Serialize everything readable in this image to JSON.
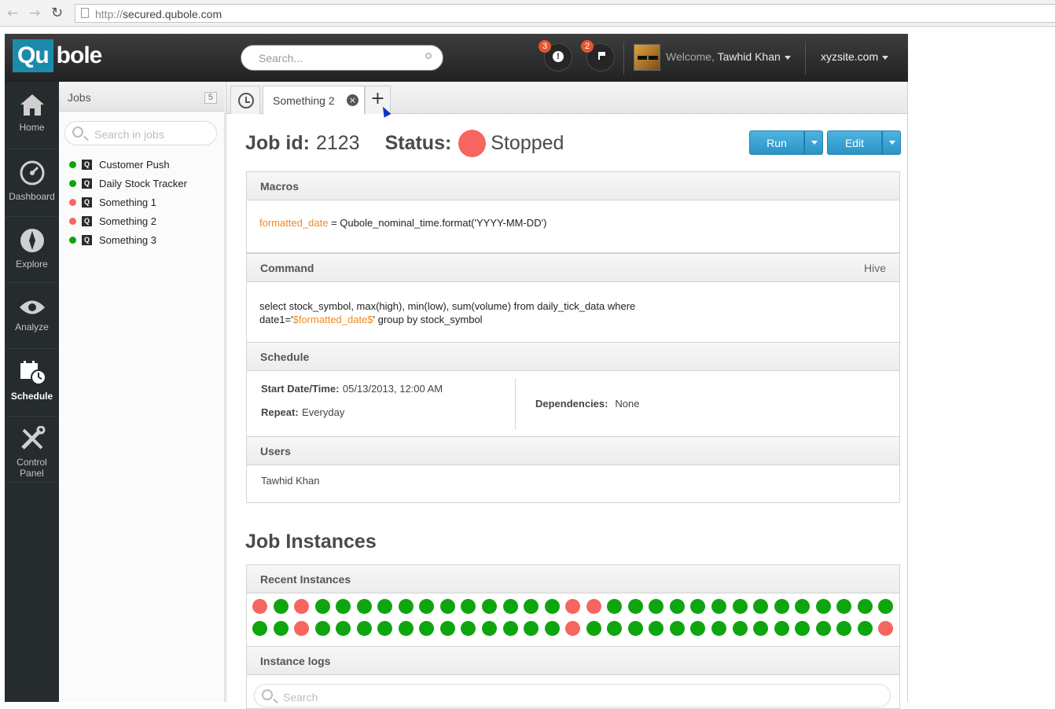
{
  "browser": {
    "url_protocol": "http://",
    "url_host": "secured.qubole.com",
    "back_glyph": "←",
    "forward_glyph": "→",
    "reload_glyph": "↻"
  },
  "topbar": {
    "logo_box": "Qu",
    "logo_rest": "bole",
    "search_placeholder": "Search...",
    "alerts_count": "3",
    "alerts_glyph": "!",
    "flags_count": "2",
    "welcome_prefix": "Welcome,",
    "user_name": "Tawhid Khan",
    "site_name": "xyzsite.com"
  },
  "leftnav": {
    "items": [
      {
        "label": "Home",
        "icon": "home-icon"
      },
      {
        "label": "Dashboard",
        "icon": "gauge-icon"
      },
      {
        "label": "Explore",
        "icon": "compass-icon"
      },
      {
        "label": "Analyze",
        "icon": "eye-icon"
      },
      {
        "label": "Schedule",
        "icon": "calendar-clock-icon"
      },
      {
        "label": "Control",
        "label2": "Panel",
        "icon": "tools-icon"
      }
    ],
    "active": "Schedule"
  },
  "jobs": {
    "title": "Jobs",
    "count": "5",
    "search_placeholder": "Search in jobs",
    "q_glyph": "Q",
    "items": [
      {
        "name": "Customer Push",
        "status": "green"
      },
      {
        "name": "Daily Stock Tracker",
        "status": "green"
      },
      {
        "name": "Something 1",
        "status": "red"
      },
      {
        "name": "Something 2",
        "status": "red"
      },
      {
        "name": "Something 3",
        "status": "green"
      }
    ]
  },
  "tabs": {
    "active_label": "Something 2",
    "close_glyph": "×",
    "new_glyph": "+"
  },
  "job": {
    "id_label": "Job id:",
    "id_value": "2123",
    "status_label": "Status:",
    "status_value": "Stopped",
    "run_label": "Run",
    "edit_label": "Edit"
  },
  "macros": {
    "title": "Macros",
    "var_name": "formatted_date",
    "rest": " = Qubole_nominal_time.format('YYYY-MM-DD')"
  },
  "command": {
    "title": "Command",
    "type": "Hive",
    "line1": "select stock_symbol, max(high), min(low), sum(volume) from daily_tick_data where",
    "line2_prefix": "date1='",
    "line2_var": "$formatted_date$",
    "line2_suffix": "' group by stock_symbol"
  },
  "schedule": {
    "title": "Schedule",
    "start_label": "Start Date/Time:",
    "start_value": "05/13/2013, 12:00 AM",
    "repeat_label": "Repeat:",
    "repeat_value": "Everyday",
    "dependencies_label": "Dependencies:",
    "dependencies_value": "None"
  },
  "users": {
    "title": "Users",
    "value": "Tawhid Khan"
  },
  "instances": {
    "heading": "Job Instances",
    "recent_title": "Recent Instances",
    "row1": [
      "red",
      "green",
      "red",
      "green",
      "green",
      "green",
      "green",
      "green",
      "green",
      "green",
      "green",
      "green",
      "green",
      "green",
      "green",
      "red",
      "red",
      "green",
      "green",
      "green",
      "green",
      "green",
      "green",
      "green",
      "green",
      "green",
      "green",
      "green",
      "green",
      "green",
      "green"
    ],
    "row2": [
      "green",
      "green",
      "red",
      "green",
      "green",
      "green",
      "green",
      "green",
      "green",
      "green",
      "green",
      "green",
      "green",
      "green",
      "green",
      "red",
      "green",
      "green",
      "green",
      "green",
      "green",
      "green",
      "green",
      "green",
      "green",
      "green",
      "green",
      "green",
      "green",
      "green",
      "red"
    ],
    "logs_title": "Instance logs",
    "logs_search_placeholder": "Search"
  },
  "colors": {
    "green": "#0ea50e",
    "red": "#f76560",
    "accent": "#2c94c6",
    "orange": "#f08a1c"
  }
}
